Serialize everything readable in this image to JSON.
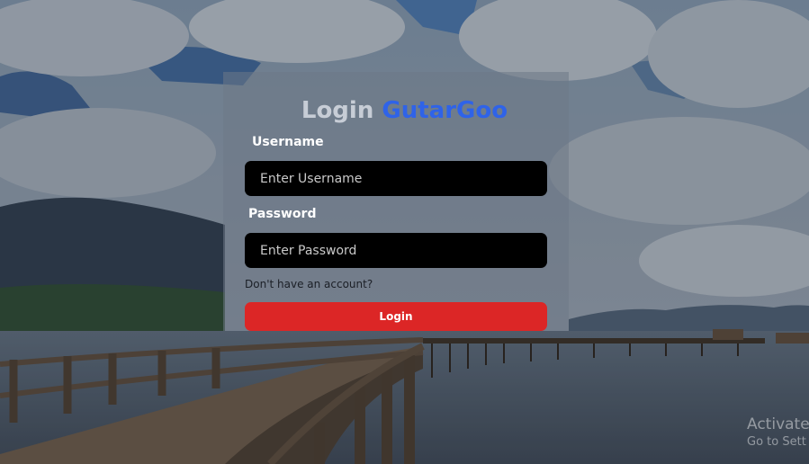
{
  "login": {
    "title": "Login",
    "brand": "GutarGoo",
    "username_label": "Username",
    "username_placeholder": "Enter Username",
    "password_label": "Password",
    "password_placeholder": "Enter Password",
    "signup_link": "Don't have an account?",
    "submit_label": "Login"
  },
  "watermark": {
    "line1": "Activate",
    "line2": "Go to Sett"
  },
  "colors": {
    "brand": "#2f63e8",
    "button": "#dc2626"
  }
}
